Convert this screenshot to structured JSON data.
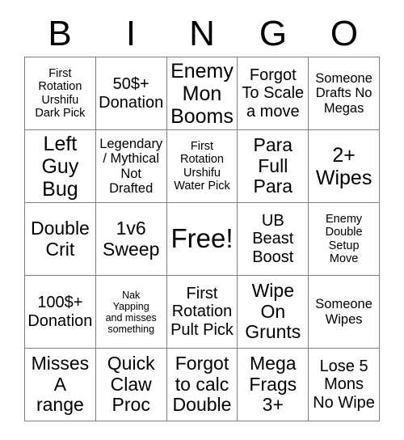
{
  "card": {
    "title_letters": [
      "B",
      "I",
      "N",
      "G",
      "O"
    ],
    "grid_size": 5,
    "free_space_index": 12,
    "colors": {
      "background": "#ffffff",
      "text": "#000000",
      "grid_line": "#808080"
    },
    "cells": [
      {
        "text": "First\nRotation\nUrshifu\nDark Pick",
        "size": "s",
        "free": false
      },
      {
        "text": "50$+\nDonation",
        "size": "l",
        "free": false
      },
      {
        "text": "Enemy\nMon\nBooms",
        "size": "xxl",
        "free": false
      },
      {
        "text": "Forgot\nTo Scale\na move",
        "size": "l",
        "free": false
      },
      {
        "text": "Someone\nDrafts No\nMegas",
        "size": "m",
        "free": false
      },
      {
        "text": "Left\nGuy\nBug",
        "size": "xxl",
        "free": false
      },
      {
        "text": "Legendary\n/ Mythical\nNot\nDrafted",
        "size": "m",
        "free": false
      },
      {
        "text": "First\nRotation\nUrshifu\nWater Pick",
        "size": "s",
        "free": false
      },
      {
        "text": "Para\nFull\nPara",
        "size": "xl",
        "free": false
      },
      {
        "text": "2+\nWipes",
        "size": "xxl",
        "free": false
      },
      {
        "text": "Double\nCrit",
        "size": "xl",
        "free": false
      },
      {
        "text": "1v6\nSweep",
        "size": "xl",
        "free": false
      },
      {
        "text": "Free!",
        "size": "free",
        "free": true
      },
      {
        "text": "UB\nBeast\nBoost",
        "size": "l",
        "free": false
      },
      {
        "text": "Enemy\nDouble\nSetup\nMove",
        "size": "s",
        "free": false
      },
      {
        "text": "100$+\nDonation",
        "size": "l",
        "free": false
      },
      {
        "text": "Nak\nYapping\nand misses\nsomething",
        "size": "xs",
        "free": false
      },
      {
        "text": "First\nRotation\nPult Pick",
        "size": "l",
        "free": false
      },
      {
        "text": "Wipe\nOn\nGrunts",
        "size": "xl",
        "free": false
      },
      {
        "text": "Someone\nWipes",
        "size": "m",
        "free": false
      },
      {
        "text": "Misses\nA\nrange",
        "size": "xl",
        "free": false
      },
      {
        "text": "Quick\nClaw\nProc",
        "size": "xl",
        "free": false
      },
      {
        "text": "Forgot\nto calc\nDouble",
        "size": "xl",
        "free": false
      },
      {
        "text": "Mega\nFrags\n3+",
        "size": "xl",
        "free": false
      },
      {
        "text": "Lose 5\nMons\nNo Wipe",
        "size": "l",
        "free": false
      }
    ]
  }
}
